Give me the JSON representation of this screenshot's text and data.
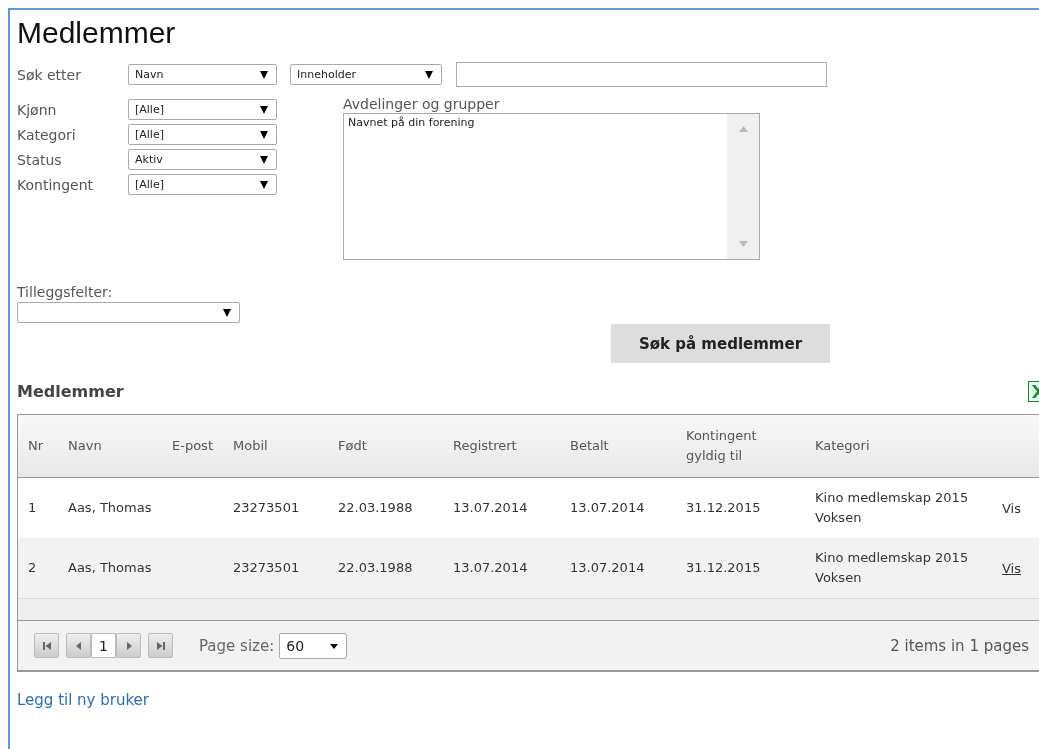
{
  "title": "Medlemmer",
  "search": {
    "label": "Søk etter",
    "field": "Navn",
    "operator": "Inneholder"
  },
  "filters": [
    {
      "label": "Kjønn",
      "value": "[Alle]"
    },
    {
      "label": "Kategori",
      "value": "[Alle]"
    },
    {
      "label": "Status",
      "value": "Aktiv"
    },
    {
      "label": "Kontingent",
      "value": "[Alle]"
    }
  ],
  "groups": {
    "label": "Avdelinger og grupper",
    "items": [
      "Navnet på din forening"
    ]
  },
  "extra_fields": {
    "label": "Tilleggsfelter:"
  },
  "search_button": "Søk på medlemmer",
  "results": {
    "heading": "Medlemmer",
    "columns": [
      "Nr",
      "Navn",
      "E-post",
      "Mobil",
      "Født",
      "Registrert",
      "Betalt",
      "Kontingent gyldig til",
      "Kategori"
    ],
    "rows": [
      {
        "cells": [
          "1",
          "Aas, Thomas",
          "",
          "23273501",
          "22.03.1988",
          "13.07.2014",
          "13.07.2014",
          "31.12.2015",
          "Kino medlemskap 2015 Voksen"
        ],
        "action": "Vis",
        "underlined": false
      },
      {
        "cells": [
          "2",
          "Aas, Thomas",
          "",
          "23273501",
          "22.03.1988",
          "13.07.2014",
          "13.07.2014",
          "31.12.2015",
          "Kino medlemskap 2015 Voksen"
        ],
        "action": "Vis",
        "underlined": true
      }
    ],
    "pager": {
      "page": "1",
      "page_size_label": "Page size:",
      "page_size": "60",
      "summary": "2 items in 1 pages"
    }
  },
  "add_link": "Legg til ny bruker"
}
